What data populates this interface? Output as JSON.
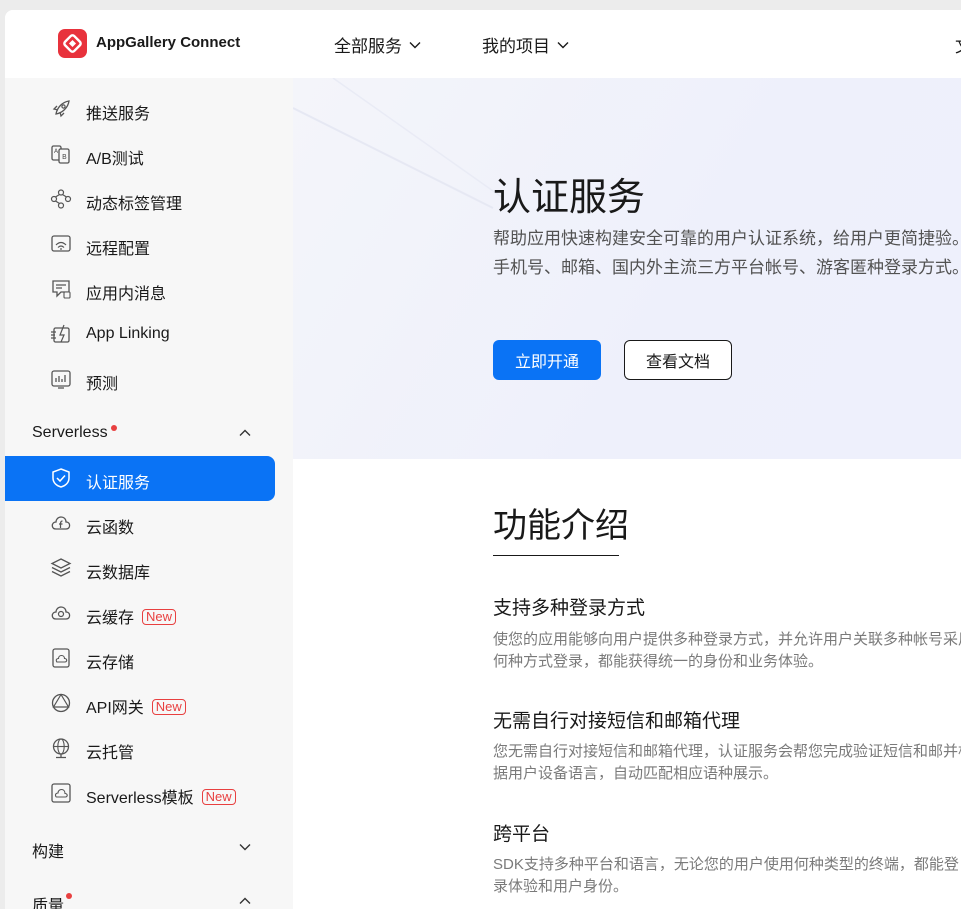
{
  "header": {
    "brand": "AppGallery Connect",
    "nav": [
      "全部服务",
      "我的项目"
    ],
    "cut_text": "文"
  },
  "sidebar": {
    "items_top": [
      {
        "label": "推送服务",
        "icon": "rocket-icon"
      },
      {
        "label": "A/B测试",
        "icon": "ab-test-icon"
      },
      {
        "label": "动态标签管理",
        "icon": "tag-graph-icon"
      },
      {
        "label": "远程配置",
        "icon": "remote-config-icon"
      },
      {
        "label": "应用内消息",
        "icon": "message-icon"
      },
      {
        "label": "App Linking",
        "icon": "app-linking-icon"
      },
      {
        "label": "预测",
        "icon": "prediction-icon"
      }
    ],
    "group_serverless": "Serverless",
    "items_serverless": [
      {
        "label": "认证服务",
        "icon": "shield-check-icon"
      },
      {
        "label": "云函数",
        "icon": "cloud-function-icon"
      },
      {
        "label": "云数据库",
        "icon": "database-layers-icon"
      },
      {
        "label": "云缓存",
        "icon": "cloud-cache-icon"
      },
      {
        "label": "云存储",
        "icon": "cloud-storage-icon"
      },
      {
        "label": "API网关",
        "icon": "api-gateway-icon"
      },
      {
        "label": "云托管",
        "icon": "globe-icon"
      },
      {
        "label": "Serverless模板",
        "icon": "template-cloud-icon"
      }
    ],
    "new_badge": "New",
    "group_build": "构建",
    "group_quality": "质量"
  },
  "hero": {
    "title": "认证服务",
    "description": "帮助应用快速构建安全可靠的用户认证系统，给用户更简捷验。支持手机号、邮箱、国内外主流三方平台帐号、游客匿种登录方式。",
    "primary_button": "立即开通",
    "secondary_button": "查看文档"
  },
  "features": {
    "section_title": "功能介绍",
    "items": [
      {
        "title": "支持多种登录方式",
        "description": "使您的应用能够向用户提供多种登录方式，并允许用户关联多种帐号采用何种方式登录，都能获得统一的身份和业务体验。"
      },
      {
        "title": "无需自行对接短信和邮箱代理",
        "description": "您无需自行对接短信和邮箱代理，认证服务会帮您完成验证短信和邮并根据用户设备语言，自动匹配相应语种展示。"
      },
      {
        "title": "跨平台",
        "description": "SDK支持多种平台和语言，无论您的用户使用何种类型的终端，都能登录体验和用户身份。"
      }
    ]
  },
  "colors": {
    "accent": "#0a73f5",
    "badge_red": "#e84040",
    "logo_red": "#e8323c"
  }
}
